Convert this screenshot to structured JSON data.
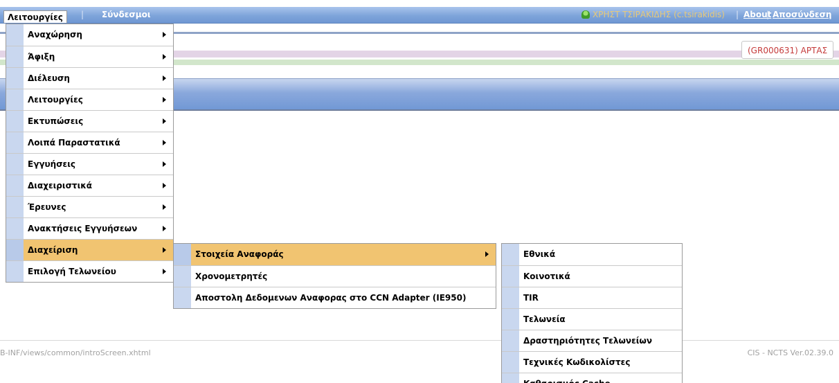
{
  "top_menu": {
    "active": "Λειτουργίες",
    "second": "Σύνδεσμοι",
    "separator": "|",
    "user": "ΧΡΗΣΤ ΤΣΙΡΑΚΙΔΗΣ (c.tsirakidis)",
    "about": "About",
    "logout": "Αποσύνδεση"
  },
  "office_badge": "(GR000631) ΑΡΤΑΣ",
  "footer": {
    "left": "B-INF/views/common/introScreen.xhtml",
    "right": "CIS - NCTS Ver.02.39.0"
  },
  "menu1": [
    {
      "label": "Αναχώρηση",
      "arrow": true
    },
    {
      "label": "Άφιξη",
      "arrow": true
    },
    {
      "label": "Διέλευση",
      "arrow": true
    },
    {
      "label": "Λειτουργίες",
      "arrow": true
    },
    {
      "label": "Εκτυπώσεις",
      "arrow": true
    },
    {
      "label": "Λοιπά Παραστατικά",
      "arrow": true
    },
    {
      "label": "Εγγυήσεις",
      "arrow": true
    },
    {
      "label": "Διαχειριστικά",
      "arrow": true
    },
    {
      "label": "Έρευνες",
      "arrow": true
    },
    {
      "label": "Ανακτήσεις Εγγυήσεων",
      "arrow": true
    },
    {
      "label": "Διαχείριση",
      "arrow": true,
      "active": true
    },
    {
      "label": "Επιλογή Τελωνείου",
      "arrow": true
    }
  ],
  "menu2": [
    {
      "label": "Στοιχεία Αναφοράς",
      "arrow": true,
      "active": true
    },
    {
      "label": "Χρονομετρητές",
      "arrow": false
    },
    {
      "label": "Αποστολη Δεδομενων Αναφορας στο CCN Adapter (IE950)",
      "arrow": false
    }
  ],
  "menu3": [
    {
      "label": "Εθνικά"
    },
    {
      "label": "Κοινοτικά"
    },
    {
      "label": "TIR"
    },
    {
      "label": "Τελωνεία"
    },
    {
      "label": "Δραστηριότητες Τελωνείων"
    },
    {
      "label": "Τεχνικές Κωδικολίστες"
    },
    {
      "label": "Καθαρισμός Cache"
    }
  ]
}
